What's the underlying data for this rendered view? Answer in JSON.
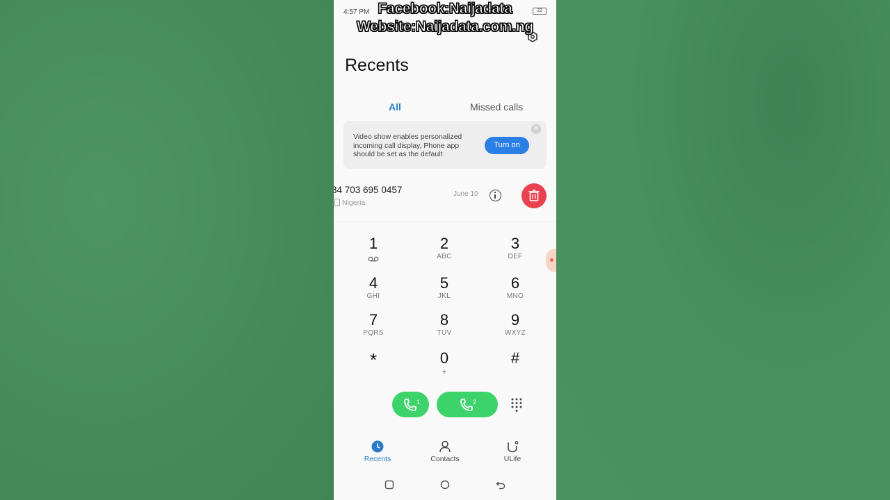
{
  "overlay": {
    "line1": "Facebook:Naijadata",
    "line2": "Website:Naijadata.com.ng"
  },
  "status_bar": {
    "time": "4:57 PM",
    "battery": "22"
  },
  "header": {
    "title": "Recents"
  },
  "tabs": [
    {
      "label": "All",
      "active": true
    },
    {
      "label": "Missed calls",
      "active": false
    }
  ],
  "banner": {
    "text": "Video show enables personalized incoming call display, Phone app should be set as the default",
    "button": "Turn on"
  },
  "recent_calls": [
    {
      "number": "34 703 695 0457",
      "location": "Nigeria",
      "date": "June 10"
    }
  ],
  "dialpad": {
    "keys": [
      {
        "digit": "1",
        "letters": ""
      },
      {
        "digit": "2",
        "letters": "ABC"
      },
      {
        "digit": "3",
        "letters": "DEF"
      },
      {
        "digit": "4",
        "letters": "GHI"
      },
      {
        "digit": "5",
        "letters": "JKL"
      },
      {
        "digit": "6",
        "letters": "MNO"
      },
      {
        "digit": "7",
        "letters": "PQRS"
      },
      {
        "digit": "8",
        "letters": "TUV"
      },
      {
        "digit": "9",
        "letters": "WXYZ"
      },
      {
        "digit": "*",
        "letters": ""
      },
      {
        "digit": "0",
        "letters": "+"
      },
      {
        "digit": "#",
        "letters": ""
      }
    ]
  },
  "call_buttons": {
    "sim1": "1",
    "sim2": "2"
  },
  "bottom_nav": [
    {
      "label": "Recents",
      "active": true
    },
    {
      "label": "Contacts",
      "active": false
    },
    {
      "label": "ULife",
      "active": false
    }
  ],
  "colors": {
    "accent": "#2a7cc8",
    "call_green": "#3cd36b",
    "delete_red": "#e8424f",
    "background_green": "#4a8f5e"
  },
  "icons": [
    "gear-icon",
    "close-icon",
    "sim-card-icon",
    "info-icon",
    "trash-icon",
    "voicemail-icon",
    "phone-icon",
    "dialpad-toggle-icon",
    "clock-icon",
    "person-icon",
    "ulife-icon",
    "square-icon",
    "circle-icon",
    "back-icon"
  ]
}
